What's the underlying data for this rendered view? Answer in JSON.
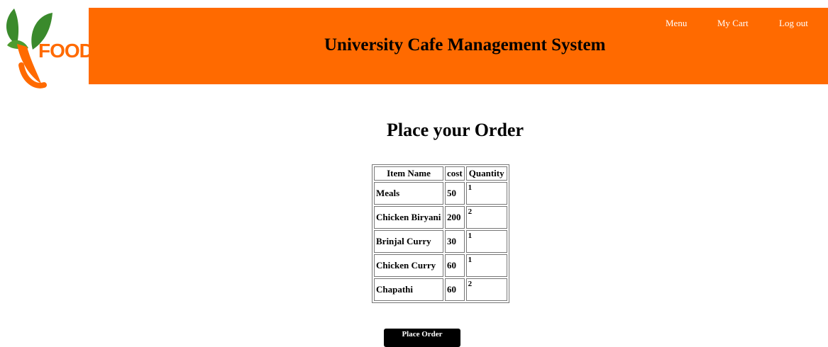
{
  "logo": {
    "text": "FOOD",
    "brand_color": "#ff6a00",
    "leaf_color": "#3a8a2c"
  },
  "header": {
    "title": "University Cafe Management System",
    "background_color": "#ff6a00",
    "nav": [
      {
        "label": "Menu"
      },
      {
        "label": "My Cart"
      },
      {
        "label": "Log out"
      }
    ]
  },
  "main": {
    "title": "Place your Order",
    "table": {
      "columns": [
        "Item Name",
        "cost",
        "Quantity"
      ],
      "rows": [
        {
          "name": "Meals",
          "cost": "50",
          "quantity": "1"
        },
        {
          "name": "Chicken Biryani",
          "cost": "200",
          "quantity": "2"
        },
        {
          "name": "Brinjal Curry",
          "cost": "30",
          "quantity": "1"
        },
        {
          "name": "Chicken Curry",
          "cost": "60",
          "quantity": "1"
        },
        {
          "name": "Chapathi",
          "cost": "60",
          "quantity": "2"
        }
      ]
    },
    "place_order_label": "Place Order"
  }
}
